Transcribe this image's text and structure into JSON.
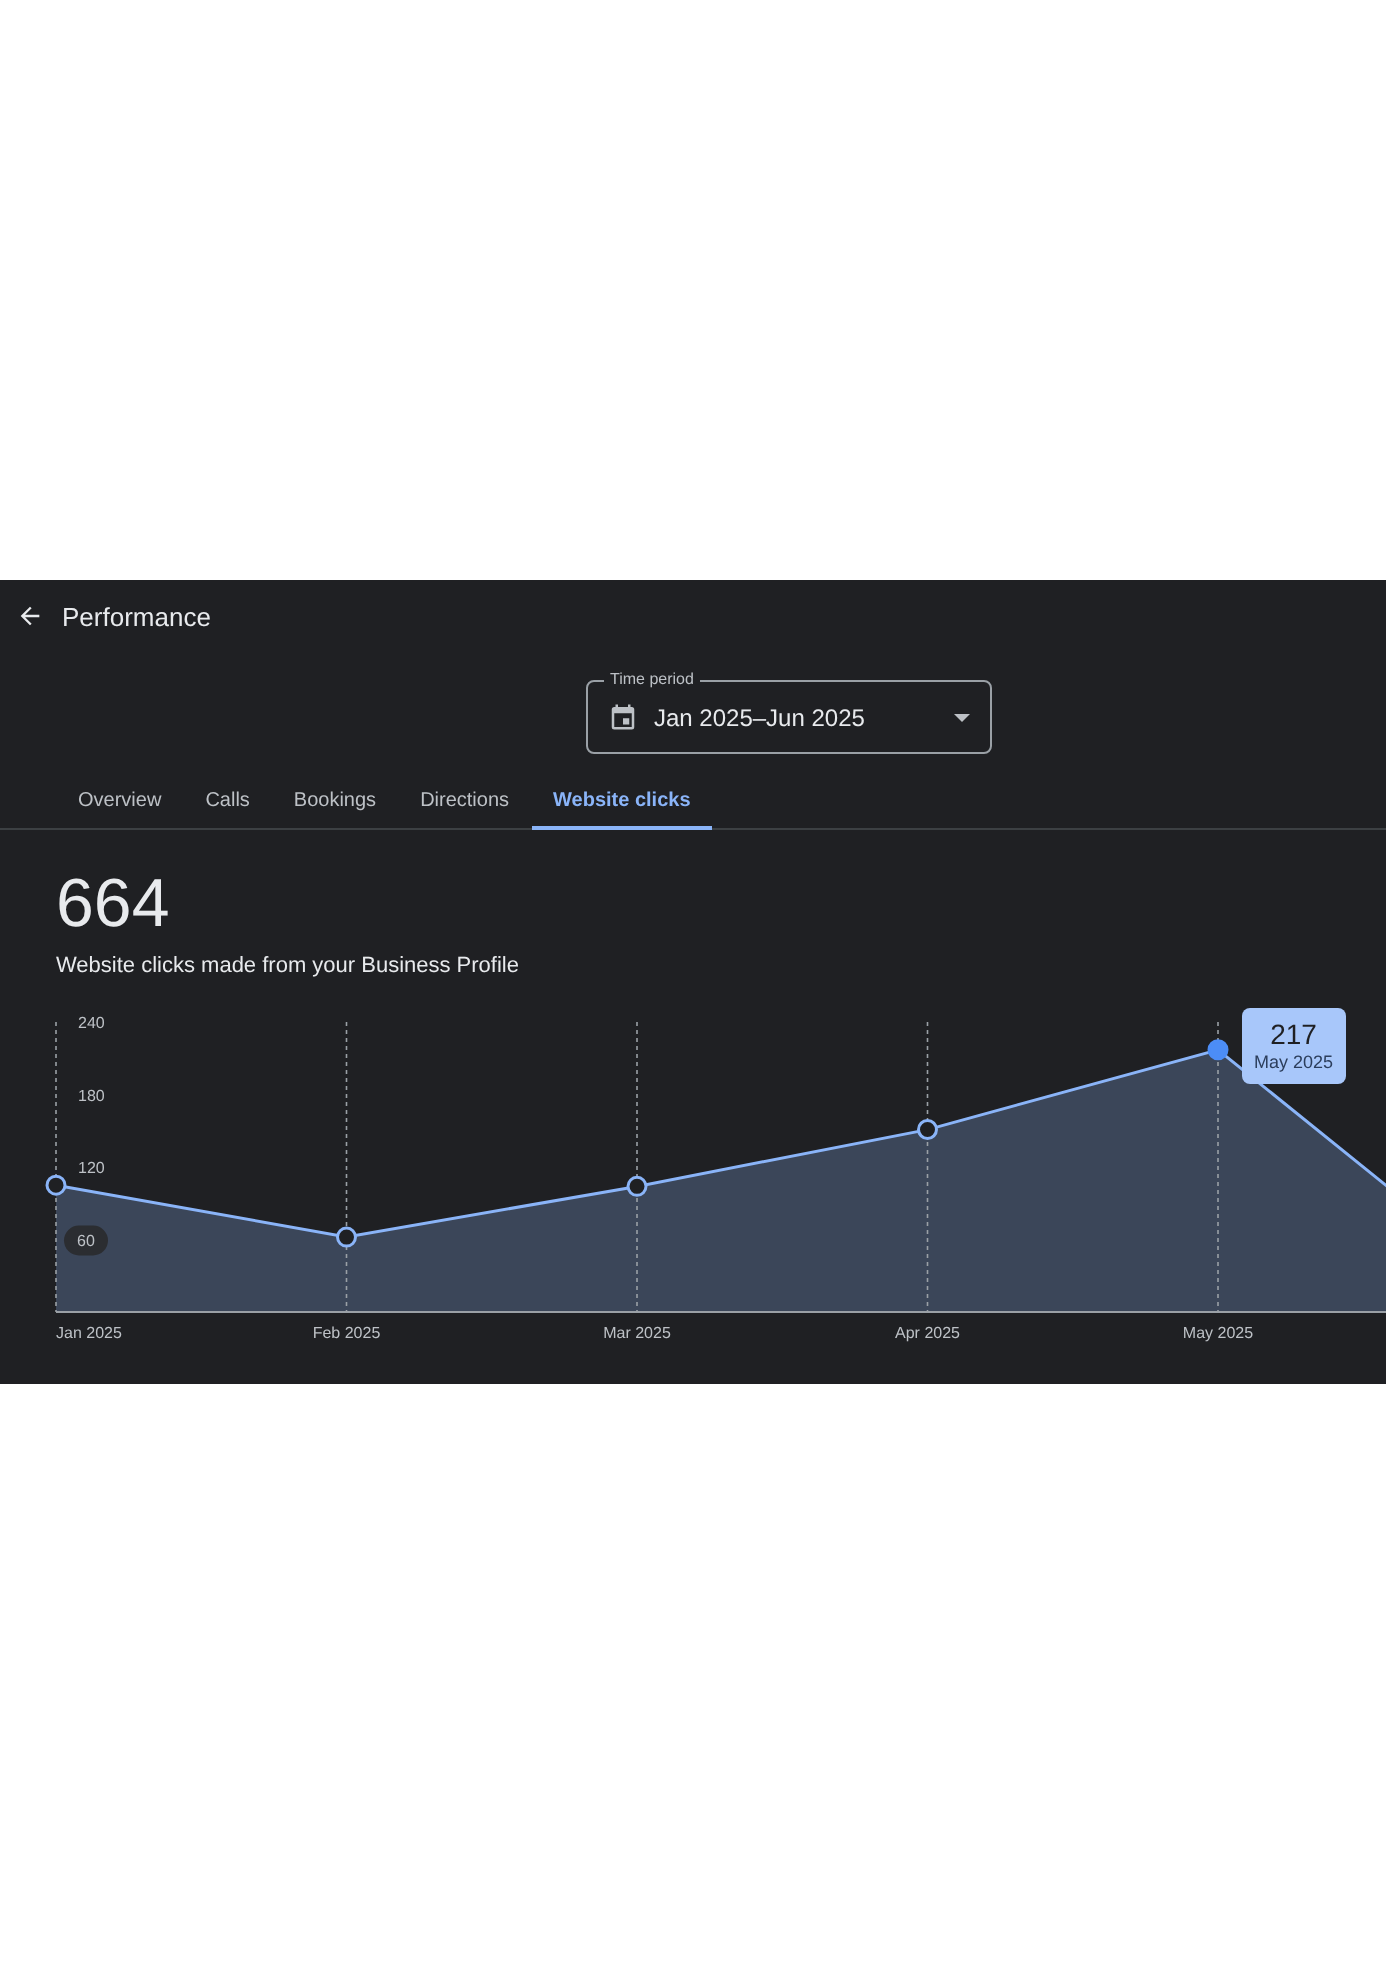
{
  "header": {
    "title": "Performance"
  },
  "time_period": {
    "label": "Time period",
    "value": "Jan 2025–Jun 2025"
  },
  "tabs": [
    {
      "label": "Overview",
      "selected": false
    },
    {
      "label": "Calls",
      "selected": false
    },
    {
      "label": "Bookings",
      "selected": false
    },
    {
      "label": "Directions",
      "selected": false
    },
    {
      "label": "Website clicks",
      "selected": true
    }
  ],
  "summary": {
    "total": "664",
    "caption": "Website clicks made from your Business Profile"
  },
  "chart": {
    "highlighted_tick": "60",
    "tooltip": {
      "value": "217",
      "label": "May 2025"
    },
    "chart_data": {
      "type": "area",
      "categories": [
        "Jan 2025",
        "Feb 2025",
        "Mar 2025",
        "Apr 2025",
        "May 2025",
        null
      ],
      "ylim": [
        0,
        240
      ],
      "grid": true,
      "yticks": [
        60,
        120,
        180,
        240
      ],
      "series": [
        {
          "color": "#8ab4f8",
          "values": [
            105,
            62,
            104,
            151,
            217,
            23
          ]
        }
      ]
    }
  }
}
